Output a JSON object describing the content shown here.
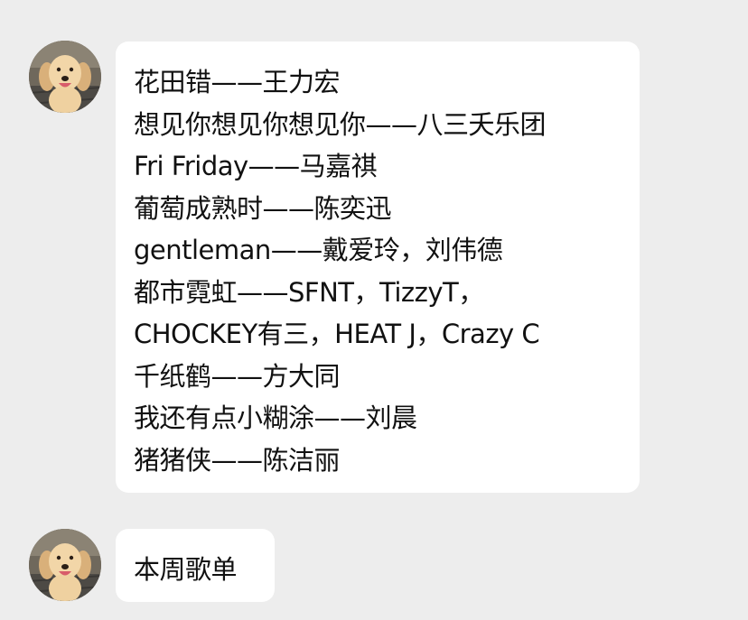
{
  "messages": [
    {
      "avatar": "golden-retriever-puppy-avatar",
      "lines": [
        "花田错——王力宏",
        "想见你想见你想见你——八三夭乐团",
        "Fri Friday——马嘉祺",
        "葡萄成熟时——陈奕迅",
        "gentleman——戴爱玲，刘伟德",
        "都市霓虹——SFNT，TizzyT，",
        "CHOCKEY有三，HEAT J，Crazy C",
        "千纸鹤——方大同",
        "我还有点小糊涂——刘晨",
        "猪猪侠——陈洁丽"
      ]
    },
    {
      "avatar": "golden-retriever-puppy-avatar",
      "lines": [
        "本周歌单"
      ]
    }
  ],
  "colors": {
    "background": "#ededed",
    "bubble": "#ffffff",
    "text": "#111111"
  }
}
